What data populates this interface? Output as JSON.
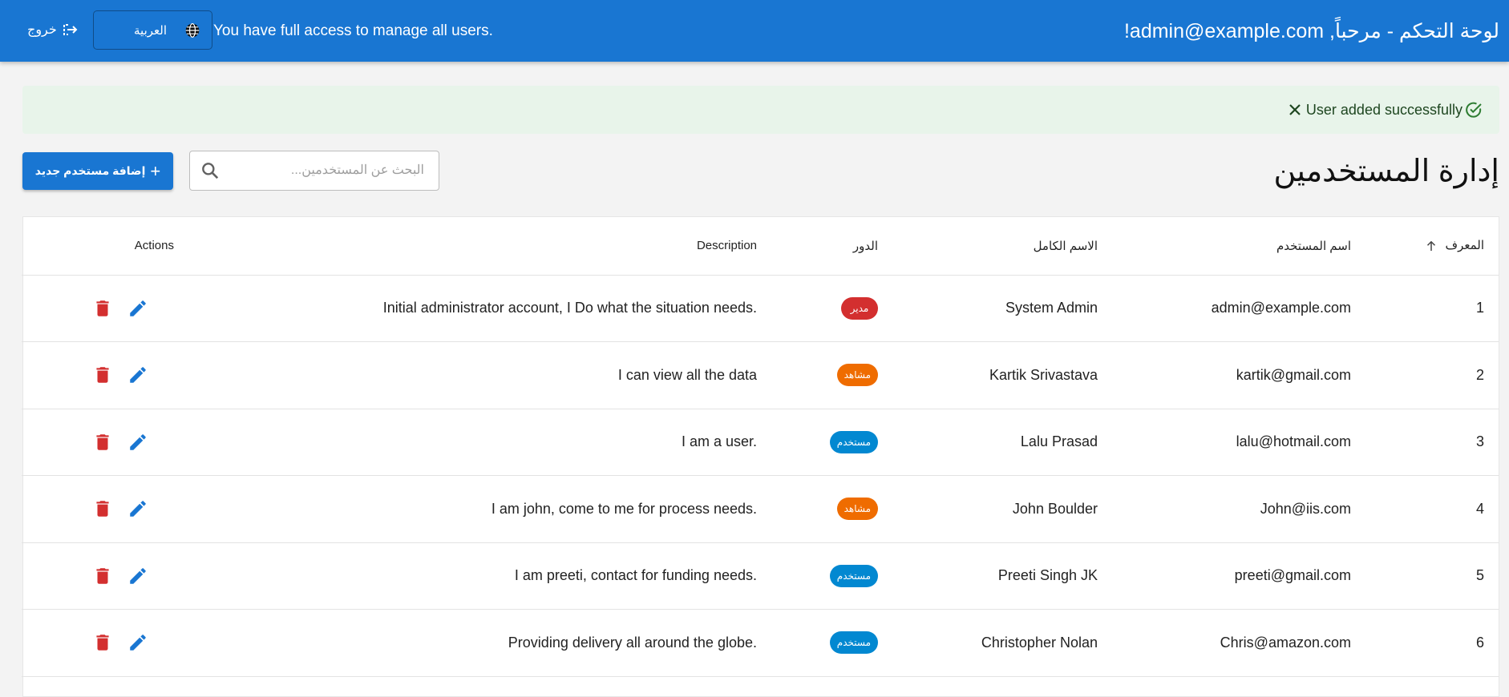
{
  "header": {
    "title": "لوحة التحكم - مرحباً, admin@example.com!",
    "access_text": "You have full access to manage all users.",
    "language_label": "العربية",
    "logout_label": "خروج",
    "bg_color": "#1976d2"
  },
  "alert": {
    "message": "User added successfully",
    "icon": "check-circle-icon",
    "close_icon": "close-icon"
  },
  "page": {
    "title": "إدارة المستخدمين",
    "search_placeholder": "البحث عن المستخدمين...",
    "add_button_label": "إضافة مستخدم جديد"
  },
  "table": {
    "columns": {
      "id": "المعرف",
      "username": "اسم المستخدم",
      "full_name": "الاسم الكامل",
      "role": "الدور",
      "description": "Description",
      "actions": "Actions"
    },
    "rows": [
      {
        "id": "1",
        "username": "admin@example.com",
        "full_name": "System Admin",
        "role": "مدير",
        "role_type": "admin",
        "description": "Initial administrator account, I Do what the situation needs."
      },
      {
        "id": "2",
        "username": "kartik@gmail.com",
        "full_name": "Kartik Srivastava",
        "role": "مشاهد",
        "role_type": "viewer",
        "description": "I can view all the data"
      },
      {
        "id": "3",
        "username": "lalu@hotmail.com",
        "full_name": "Lalu Prasad",
        "role": "مستخدم",
        "role_type": "user",
        "description": "I am a user."
      },
      {
        "id": "4",
        "username": "John@iis.com",
        "full_name": "John Boulder",
        "role": "مشاهد",
        "role_type": "viewer",
        "description": "I am john, come to me for process needs."
      },
      {
        "id": "5",
        "username": "preeti@gmail.com",
        "full_name": "Preeti Singh JK",
        "role": "مستخدم",
        "role_type": "user",
        "description": "I am preeti, contact for funding needs."
      },
      {
        "id": "6",
        "username": "Chris@amazon.com",
        "full_name": "Christopher Nolan",
        "role": "مستخدم",
        "role_type": "user",
        "description": "Providing delivery all around the globe."
      }
    ]
  },
  "colors": {
    "admin_badge": "#d32f2f",
    "viewer_badge": "#ef6c00",
    "user_badge": "#0288d1",
    "delete_icon": "#d32f2f",
    "edit_icon": "#1976d2"
  }
}
